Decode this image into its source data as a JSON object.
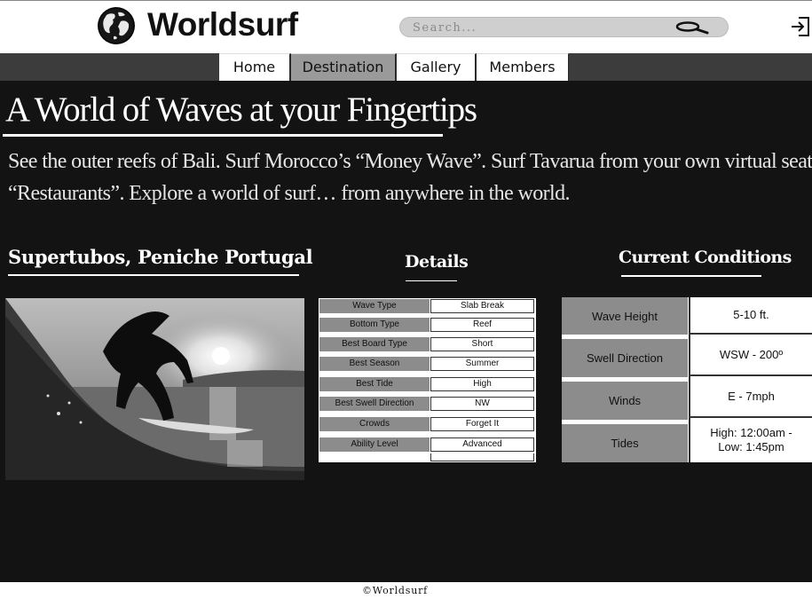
{
  "header": {
    "brand": "Worldsurf",
    "search_placeholder": "Search..."
  },
  "nav": {
    "tabs": [
      {
        "label": "Home",
        "active": false
      },
      {
        "label": "Destination",
        "active": true
      },
      {
        "label": "Gallery",
        "active": false
      },
      {
        "label": "Members",
        "active": false
      }
    ]
  },
  "hero": {
    "title": "A World of Waves at your Fingertips",
    "line1": "See the outer reefs of Bali. Surf Morocco’s “Money Wave”. Surf Tavarua from your own virtual seat at",
    "line2": "“Restaurants”. Explore a world of surf… from anywhere in the world."
  },
  "spot": {
    "title": "Supertubos, Peniche Portugal"
  },
  "details": {
    "title": "Details",
    "rows": [
      {
        "key": "Wave Type",
        "value": "Slab Break"
      },
      {
        "key": "Bottom Type",
        "value": "Reef"
      },
      {
        "key": "Best Board Type",
        "value": "Short"
      },
      {
        "key": "Best Season",
        "value": "Summer"
      },
      {
        "key": "Best Tide",
        "value": "High"
      },
      {
        "key": "Best Swell Direction",
        "value": "NW"
      },
      {
        "key": "Crowds",
        "value": "Forget It"
      },
      {
        "key": "Ability Level",
        "value": "Advanced"
      }
    ]
  },
  "conditions": {
    "title": "Current Conditions",
    "rows": [
      {
        "key": "Wave Height",
        "value": "5-10 ft."
      },
      {
        "key": "Swell Direction",
        "value": "WSW - 200º"
      },
      {
        "key": "Winds",
        "value": "E - 7mph"
      },
      {
        "key": "Tides",
        "value": "High: 12:00am -\nLow: 1:45pm"
      }
    ]
  },
  "footer": {
    "text": "©Worldsurf"
  },
  "colors": {
    "main_bg": "#131313",
    "nav_bg": "#3c3c3c",
    "active_tab": "#9a9a9a",
    "key_cell": "#8c8c8c"
  }
}
